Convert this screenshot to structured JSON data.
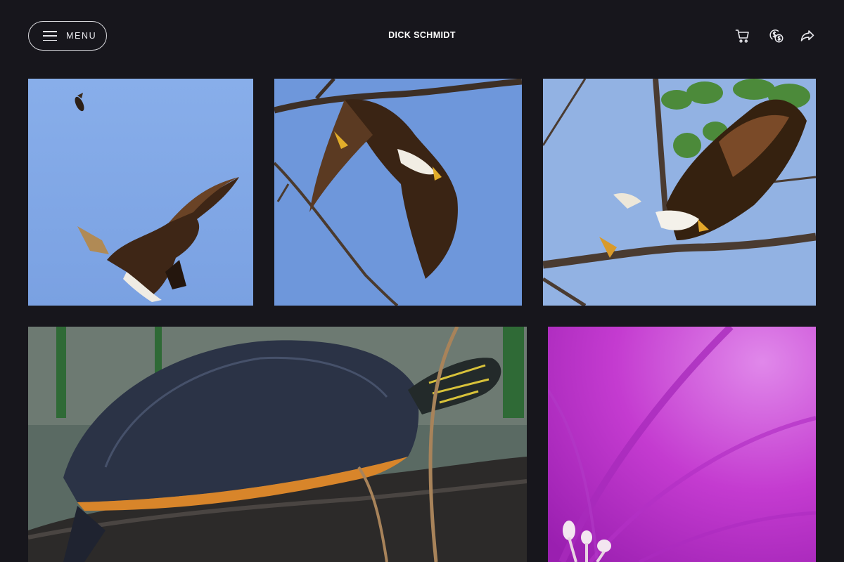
{
  "header": {
    "menu_label": "MENU",
    "site_title": "DICK SCHMIDT",
    "icons": [
      "cart-icon",
      "currency-icon",
      "share-icon"
    ]
  },
  "gallery": {
    "photos": [
      {
        "subject": "bald-eagle-diving",
        "color": "#7fa7e6"
      },
      {
        "subject": "bald-eagle-launching-from-branch",
        "color": "#6d96da"
      },
      {
        "subject": "bald-eagle-taking-off-from-branch",
        "color": "#93b4e5"
      },
      {
        "subject": "painted-turtle-on-log",
        "color": "#3b4452"
      },
      {
        "subject": "magenta-flower-macro",
        "color": "#c43bd0"
      }
    ]
  },
  "colors": {
    "background": "#17161c",
    "text": "#ffffff"
  }
}
